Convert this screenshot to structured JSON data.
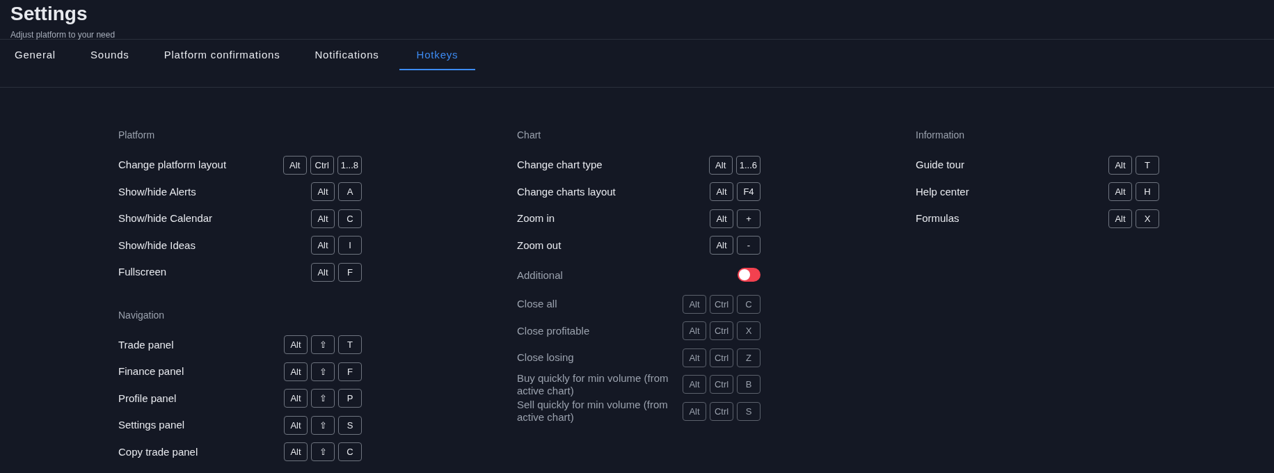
{
  "header": {
    "title": "Settings",
    "subtitle": "Adjust platform to your need"
  },
  "tabs": [
    {
      "label": "General",
      "selected": false
    },
    {
      "label": "Sounds",
      "selected": false
    },
    {
      "label": "Platform confirmations",
      "selected": false
    },
    {
      "label": "Notifications",
      "selected": false
    },
    {
      "label": "Hotkeys",
      "selected": true
    }
  ],
  "columns": [
    {
      "sections": [
        {
          "heading": "Platform",
          "items": [
            {
              "label": "Change platform layout",
              "keys": [
                "Alt",
                "Ctrl",
                "1...8"
              ]
            },
            {
              "label": "Show/hide Alerts",
              "keys": [
                "Alt",
                "A"
              ]
            },
            {
              "label": "Show/hide Calendar",
              "keys": [
                "Alt",
                "C"
              ]
            },
            {
              "label": "Show/hide Ideas",
              "keys": [
                "Alt",
                "I"
              ]
            },
            {
              "label": "Fullscreen",
              "keys": [
                "Alt",
                "F"
              ]
            }
          ]
        },
        {
          "heading": "Navigation",
          "items": [
            {
              "label": "Trade panel",
              "keys": [
                "Alt",
                "⇧",
                "T"
              ]
            },
            {
              "label": "Finance panel",
              "keys": [
                "Alt",
                "⇧",
                "F"
              ]
            },
            {
              "label": "Profile panel",
              "keys": [
                "Alt",
                "⇧",
                "P"
              ]
            },
            {
              "label": "Settings panel",
              "keys": [
                "Alt",
                "⇧",
                "S"
              ]
            },
            {
              "label": "Copy trade panel",
              "keys": [
                "Alt",
                "⇧",
                "C"
              ]
            }
          ]
        }
      ]
    },
    {
      "sections": [
        {
          "heading": "Chart",
          "items": [
            {
              "label": "Change chart type",
              "keys": [
                "Alt",
                "1...6"
              ]
            },
            {
              "label": "Change charts layout",
              "keys": [
                "Alt",
                "F4"
              ]
            },
            {
              "label": "Zoom in",
              "keys": [
                "Alt",
                "+"
              ]
            },
            {
              "label": "Zoom out",
              "keys": [
                "Alt",
                "-"
              ]
            }
          ],
          "additional": {
            "label": "Additional",
            "on": false,
            "items": [
              {
                "label": "Close all",
                "keys": [
                  "Alt",
                  "Ctrl",
                  "C"
                ]
              },
              {
                "label": "Close profitable",
                "keys": [
                  "Alt",
                  "Ctrl",
                  "X"
                ]
              },
              {
                "label": "Close losing",
                "keys": [
                  "Alt",
                  "Ctrl",
                  "Z"
                ]
              },
              {
                "label": "Buy quickly for min volume (from active chart)",
                "keys": [
                  "Alt",
                  "Ctrl",
                  "B"
                ]
              },
              {
                "label": "Sell quickly for min volume (from active chart)",
                "keys": [
                  "Alt",
                  "Ctrl",
                  "S"
                ]
              }
            ]
          }
        }
      ]
    },
    {
      "sections": [
        {
          "heading": "Information",
          "items": [
            {
              "label": "Guide tour",
              "keys": [
                "Alt",
                "T"
              ]
            },
            {
              "label": "Help center",
              "keys": [
                "Alt",
                "H"
              ]
            },
            {
              "label": "Formulas",
              "keys": [
                "Alt",
                "X"
              ]
            }
          ]
        }
      ]
    }
  ]
}
